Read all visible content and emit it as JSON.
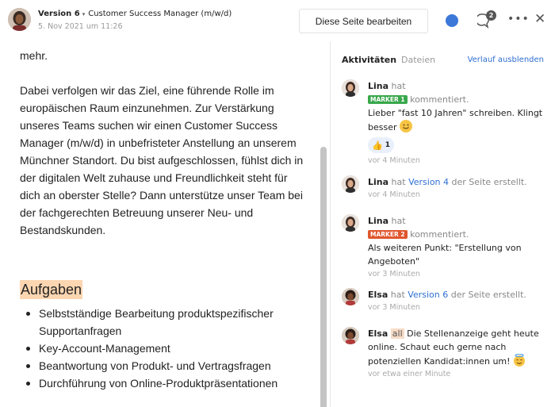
{
  "header": {
    "version_label": "Version 6",
    "caret": "▾",
    "page_title": "Customer Success Manager (m/w/d)",
    "date": "5. Nov 2021 um 11:26",
    "edit_button_label": "Diese Seite bearbeiten",
    "comment_count": "2",
    "more_label": "•••",
    "close_label": "✕",
    "status_color": "#3b78d8"
  },
  "content": {
    "paragraph_1": "mehr.",
    "paragraph_2": "Dabei verfolgen wir das Ziel, eine führende Rolle im europäischen Raum einzunehmen. Zur Verstärkung unseres Teams suchen wir einen Customer Success Manager (m/w/d) in unbefristeter Anstellung an unserem Münchner Standort. Du bist aufgeschlossen, fühlst dich in der digitalen Welt zuhause und Freundlichkeit steht für dich an oberster Stelle? Dann unterstütze unser Team bei der fachgerechten Betreuung unserer Neu- und Bestandskunden.",
    "section_heading": "Aufgaben",
    "tasks": [
      "Selbstständige Bearbeitung produktspezifischer Supportanfragen",
      "Key-Account-Management",
      "Beantwortung von Produkt- und Vertragsfragen",
      "Durchführung von Online-Produktpräsentationen"
    ]
  },
  "panel": {
    "tab_activities": "Aktivitäten",
    "tab_files": "Dateien",
    "history_link": "Verlauf ausblenden",
    "entries": [
      {
        "user": "Lina",
        "verb": "hat",
        "marker": "MARKER 1",
        "action": "kommentiert.",
        "text": "Lieber \"fast 10 Jahren\" schreiben. Klingt besser",
        "reaction_emoji": "👍",
        "reaction_count": "1",
        "time": "vor 4 Minuten"
      },
      {
        "user": "Lina",
        "verb": "hat",
        "version_link": "Version 4",
        "action": "der Seite erstellt.",
        "time": "vor 4 Minuten"
      },
      {
        "user": "Lina",
        "verb": "hat",
        "marker": "MARKER 2",
        "action": "kommentiert.",
        "text": "Als weiteren Punkt: \"Erstellung von Angeboten\"",
        "time": "vor 3 Minuten"
      },
      {
        "user": "Elsa",
        "verb": "hat",
        "version_link": "Version 6",
        "action": "der Seite erstellt.",
        "time": "vor 3 Minuten"
      },
      {
        "user": "Elsa",
        "mention": "all",
        "text": "Die Stellenanzeige geht heute online. Schaut euch gerne nach potenziellen Kandidat:innen um!",
        "time": "vor etwa einer Minute"
      }
    ]
  },
  "icons": {
    "avatar": "avatar-icon",
    "comment": "speech-bubble-icon",
    "more": "ellipsis-icon",
    "close": "close-icon",
    "smile": "smile-emoji-icon",
    "halo": "halo-emoji-icon"
  }
}
